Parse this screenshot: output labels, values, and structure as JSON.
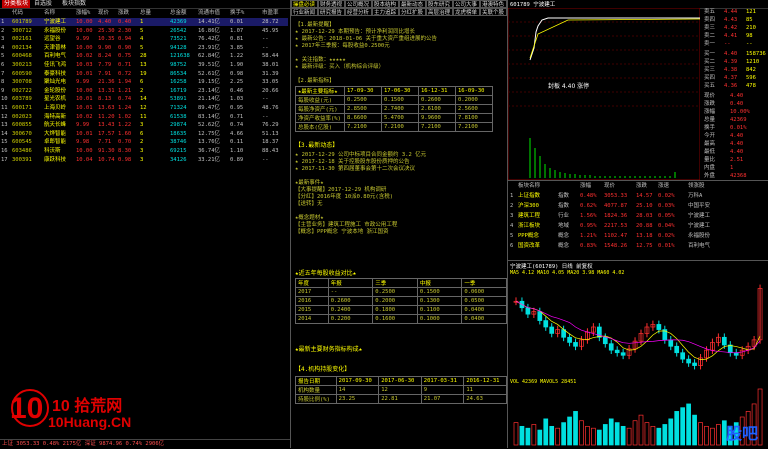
{
  "top_tabs": [
    "分类板块",
    "自选股",
    "板块指数"
  ],
  "list": {
    "headers": [
      "",
      "代码",
      "名称",
      "涨幅%",
      "现价",
      "涨跌",
      "总量",
      "总金额",
      "流通市值",
      "换手%",
      "市盈率"
    ],
    "rows": [
      [
        "1",
        "601789",
        "宁波建工",
        "10.00",
        "4.40",
        "0.40",
        "1",
        "42369",
        "14.41亿",
        "0.01",
        "28.72"
      ],
      [
        "2",
        "300712",
        "永福股份",
        "10.00",
        "25.30",
        "2.30",
        "5",
        "26542",
        "16.86亿",
        "1.07",
        "45.95"
      ],
      [
        "3",
        "002161",
        "远望谷",
        "9.99",
        "10.35",
        "0.94",
        "4",
        "73521",
        "76.42亿",
        "0.81",
        "--"
      ],
      [
        "4",
        "002134",
        "天津普林",
        "10.00",
        "9.90",
        "0.90",
        "5",
        "94128",
        "23.91亿",
        "3.85",
        "--"
      ],
      [
        "5",
        "600468",
        "百利电气",
        "10.02",
        "8.24",
        "0.75",
        "28",
        "121638",
        "62.84亿",
        "1.22",
        "58.44"
      ],
      [
        "6",
        "300213",
        "佳讯飞鸿",
        "10.03",
        "7.79",
        "0.71",
        "13",
        "98752",
        "39.51亿",
        "1.90",
        "38.01"
      ],
      [
        "7",
        "600590",
        "泰豪科技",
        "10.01",
        "7.91",
        "0.72",
        "19",
        "86534",
        "52.61亿",
        "0.98",
        "31.39"
      ],
      [
        "8",
        "300708",
        "聚灿光电",
        "9.99",
        "21.36",
        "1.94",
        "6",
        "16258",
        "19.15亿",
        "2.25",
        "33.05"
      ],
      [
        "9",
        "002722",
        "金轮股份",
        "10.00",
        "13.31",
        "1.21",
        "2",
        "16719",
        "23.14亿",
        "0.46",
        "20.66"
      ],
      [
        "10",
        "603789",
        "星光农机",
        "10.01",
        "8.13",
        "0.74",
        "14",
        "53891",
        "21.14亿",
        "1.03",
        "--"
      ],
      [
        "11",
        "600171",
        "上海贝岭",
        "10.01",
        "13.63",
        "1.24",
        "12",
        "71324",
        "89.47亿",
        "0.95",
        "48.76"
      ],
      [
        "12",
        "002023",
        "海特高新",
        "10.02",
        "11.20",
        "1.02",
        "11",
        "61538",
        "83.14亿",
        "0.71",
        "--"
      ],
      [
        "13",
        "600855",
        "航天长峰",
        "9.99",
        "13.43",
        "1.22",
        "3",
        "29874",
        "52.62亿",
        "0.74",
        "76.29"
      ],
      [
        "14",
        "300670",
        "大烨智能",
        "10.01",
        "17.57",
        "1.60",
        "6",
        "18635",
        "12.75亿",
        "4.66",
        "51.13"
      ],
      [
        "15",
        "600545",
        "卓郎智能",
        "9.98",
        "7.71",
        "0.70",
        "2",
        "38746",
        "13.76亿",
        "0.11",
        "18.37"
      ],
      [
        "16",
        "603486",
        "科沃斯",
        "10.00",
        "91.30",
        "8.30",
        "3",
        "69215",
        "36.74亿",
        "1.10",
        "88.43"
      ],
      [
        "17",
        "300391",
        "康跃科技",
        "10.04",
        "10.74",
        "0.98",
        "3",
        "34126",
        "33.21亿",
        "0.89",
        "--"
      ]
    ]
  },
  "status_bar": "上证 3053.33  0.48%  2175亿  深证 9874.96  0.74%  2906亿",
  "f10": {
    "tabs": [
      "操盘必读",
      "财务透视",
      "公司概况",
      "股本结构",
      "最新动态",
      "股东研究",
      "公司大事",
      "港澳特色",
      "行业新闻",
      "研究报告",
      "经营分析",
      "主力追踪",
      "分红扩股",
      "高层治理",
      "龙虎榜单",
      "关联个股"
    ],
    "intro_lines": [
      "【1.最新提醒】",
      "★ 2017-12-29 本期预告：预计净利润同比增长",
      "★ 最新公告：2018-01-06 关于重大资产重组进展的公告",
      "★ 2017年三季报：每股收益0.2500元",
      "",
      "★ 关注指数：★★★★★",
      "★ 最新评级：买入（机构综合评级）",
      "",
      "【2.最新指标】"
    ],
    "indicator_head": [
      "★最新主要指标★",
      "17-09-30",
      "17-06-30",
      "16-12-31",
      "16-09-30"
    ],
    "indicator_rows": [
      [
        "每股收益(元)",
        "0.2500",
        "0.1500",
        "0.2600",
        "0.2000"
      ],
      [
        "每股净资产(元)",
        "2.8500",
        "2.7400",
        "2.6100",
        "2.5600"
      ],
      [
        "净资产收益率(%)",
        "8.6600",
        "5.4700",
        "9.9600",
        "7.8100"
      ],
      [
        "总股本(亿股)",
        "7.2100",
        "7.2100",
        "7.2100",
        "7.2100"
      ]
    ],
    "news_head": "【3.最新动态】",
    "news_lines": [
      "★ 2017-12-29 公司中标项目合同金额约 3.2 亿元",
      "★ 2017-12-18 关于控股股东股份质押的公告",
      "★ 2017-11-30 第四届董事会第十二次会议决议",
      "",
      "★最新事件★",
      "【大事提醒】2017-12-29 机构调研",
      "【分红】2016年度 10派0.80元(含税)",
      "【送转】无",
      "",
      "★概念题材★",
      "【主营业务】建筑工程施工 市政公用工程",
      "【概念】PPP概念 宁波本地 浙江国资"
    ],
    "holders_head": "★近五年每股收益对比★",
    "holders_table_head": [
      "年度",
      "年报",
      "三季",
      "中报",
      "一季"
    ],
    "holders_rows": [
      [
        "2017",
        "--",
        "0.2500",
        "0.1500",
        "0.0600"
      ],
      [
        "2016",
        "0.2600",
        "0.2000",
        "0.1300",
        "0.0500"
      ],
      [
        "2015",
        "0.2400",
        "0.1800",
        "0.1100",
        "0.0400"
      ],
      [
        "2014",
        "0.2200",
        "0.1600",
        "0.1000",
        "0.0400"
      ]
    ],
    "fund_head": "★最新主要财务指标构成★",
    "lhb_head": "【4.机构持股变化】",
    "lhb_table_head": [
      "报告日期",
      "2017-09-30",
      "2017-06-30",
      "2017-03-31",
      "2016-12-31"
    ],
    "lhb_rows": [
      [
        "机构数量",
        "14",
        "12",
        "9",
        "11"
      ],
      [
        "持股比例(%)",
        "23.25",
        "22.81",
        "21.07",
        "24.63"
      ]
    ]
  },
  "quote": {
    "code": "601789",
    "name": "宁波建工",
    "sell": [
      [
        "卖五",
        "4.44",
        "121"
      ],
      [
        "卖四",
        "4.43",
        "85"
      ],
      [
        "卖三",
        "4.42",
        "210"
      ],
      [
        "卖二",
        "4.41",
        "98"
      ],
      [
        "卖一",
        "--",
        "--"
      ]
    ],
    "buy": [
      [
        "买一",
        "4.40",
        "158736"
      ],
      [
        "买二",
        "4.39",
        "1210"
      ],
      [
        "买三",
        "4.38",
        "842"
      ],
      [
        "买四",
        "4.37",
        "596"
      ],
      [
        "买五",
        "4.36",
        "478"
      ]
    ],
    "stats": [
      [
        "现价",
        "4.40"
      ],
      [
        "涨跌",
        "0.40"
      ],
      [
        "涨幅",
        "10.00%"
      ],
      [
        "总量",
        "42369"
      ],
      [
        "换手",
        "0.01%"
      ],
      [
        "今开",
        "4.40"
      ],
      [
        "最高",
        "4.40"
      ],
      [
        "最低",
        "4.40"
      ],
      [
        "量比",
        "2.51"
      ],
      [
        "内盘",
        "1"
      ],
      [
        "外盘",
        "42368"
      ]
    ]
  },
  "tick_note": "封板 4.40 涨停",
  "sector": {
    "headers": [
      "",
      "板块名称",
      "",
      "涨幅",
      "现价",
      "涨跌",
      "涨速",
      "领涨股"
    ],
    "rows": [
      [
        "1",
        "上证指数",
        "指数",
        "0.48%",
        "3053.33",
        "14.57",
        "0.02%",
        "万科A"
      ],
      [
        "2",
        "沪深300",
        "指数",
        "0.62%",
        "4077.87",
        "25.10",
        "0.03%",
        "中国平安"
      ],
      [
        "3",
        "建筑工程",
        "行业",
        "1.56%",
        "1824.36",
        "28.03",
        "0.05%",
        "宁波建工"
      ],
      [
        "4",
        "浙江板块",
        "地域",
        "0.95%",
        "2217.53",
        "20.88",
        "0.04%",
        "宁波建工"
      ],
      [
        "5",
        "PPP概念",
        "概念",
        "1.21%",
        "1102.47",
        "13.18",
        "0.02%",
        "永福股份"
      ],
      [
        "6",
        "国资改革",
        "概念",
        "0.83%",
        "1548.26",
        "12.75",
        "0.01%",
        "百利电气"
      ]
    ]
  },
  "kline": {
    "title": "宁波建工(601789) 日线 前复权",
    "ma_legend": "MA5 4.12 MA10 4.05 MA20 3.98 MA60 4.02",
    "vol_legend": "VOL 42369 MAVOL5 28451",
    "candles": [
      4.3,
      4.25,
      4.2,
      4.22,
      4.15,
      4.1,
      4.05,
      4.08,
      4.02,
      3.98,
      3.95,
      4.0,
      4.06,
      4.1,
      4.02,
      3.97,
      3.92,
      3.9,
      3.88,
      3.93,
      3.99,
      4.05,
      4.1,
      4.12,
      4.08,
      4.0,
      3.95,
      3.9,
      3.85,
      3.82,
      3.8,
      3.86,
      3.92,
      3.98,
      4.02,
      3.96,
      3.9,
      3.88,
      3.92,
      3.95,
      4.0,
      4.4
    ],
    "volumes": [
      12,
      10,
      9,
      11,
      8,
      14,
      10,
      9,
      12,
      15,
      18,
      13,
      10,
      9,
      8,
      11,
      14,
      12,
      10,
      9,
      13,
      16,
      12,
      10,
      9,
      11,
      14,
      18,
      20,
      22,
      16,
      12,
      10,
      9,
      11,
      13,
      10,
      12,
      15,
      18,
      22,
      30
    ]
  },
  "logo_text": "10 拾荒网",
  "logo_url": "10Huang.CN",
  "logo2_text": "股吧"
}
